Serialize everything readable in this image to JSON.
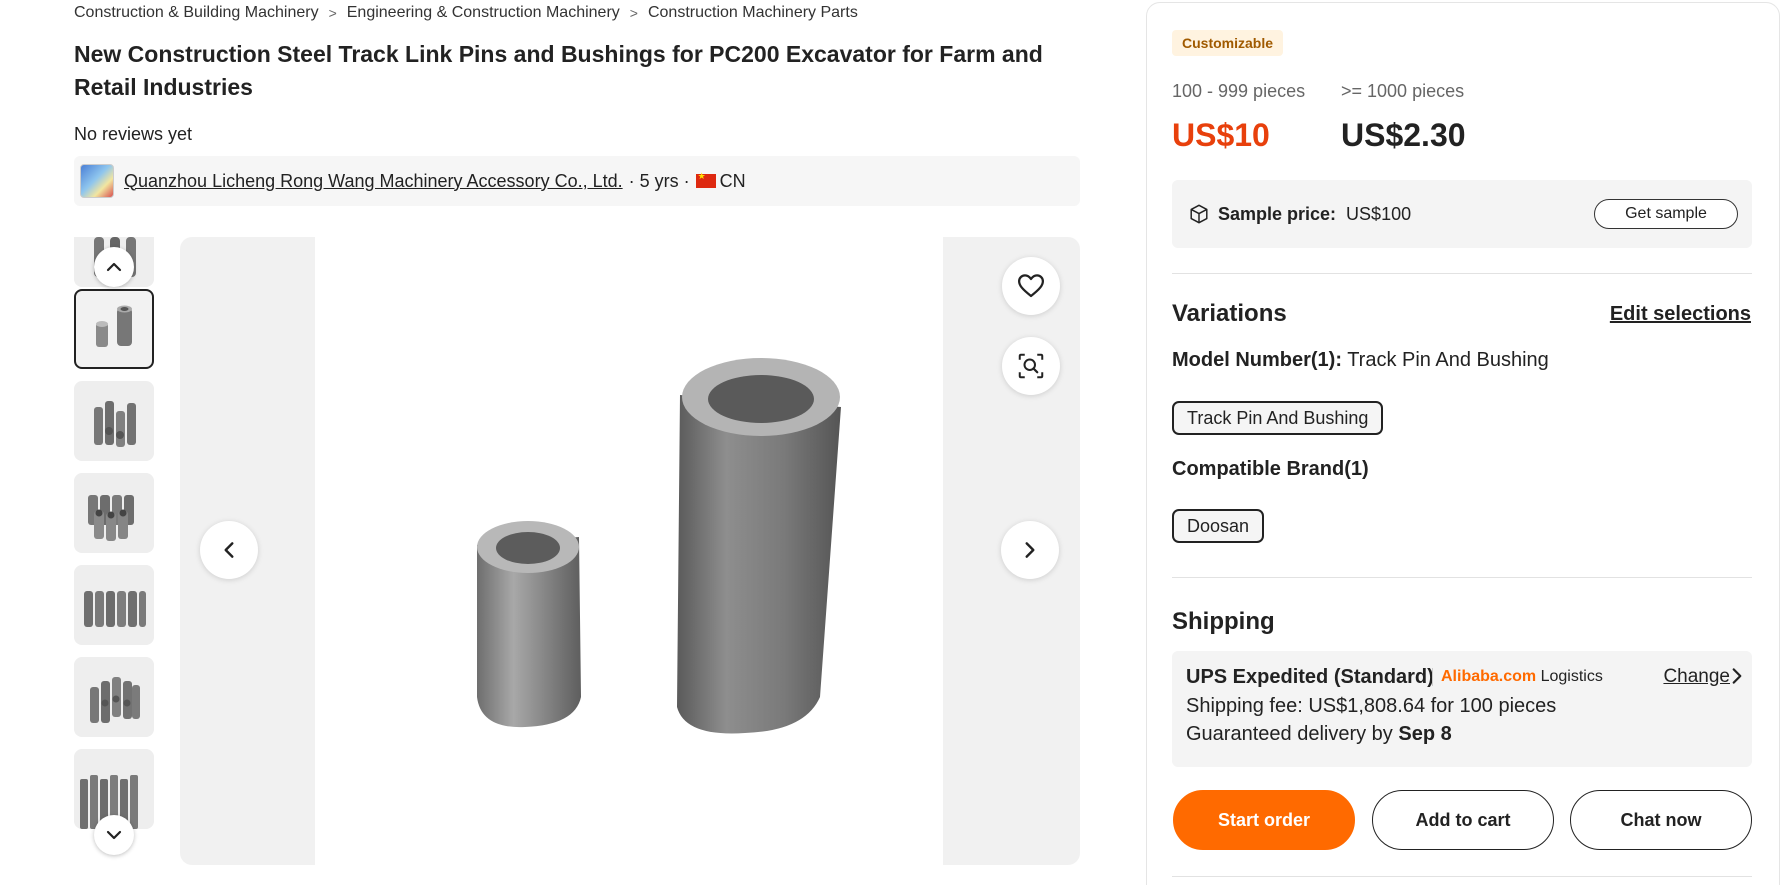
{
  "breadcrumb": [
    {
      "label": "Construction & Building Machinery"
    },
    {
      "label": "Engineering & Construction Machinery"
    },
    {
      "label": "Construction Machinery Parts"
    }
  ],
  "product": {
    "title": "New Construction Steel Track Link Pins and Bushings for PC200 Excavator for Farm and Retail Industries",
    "reviews": "No reviews yet"
  },
  "supplier": {
    "name": "Quanzhou Licheng Rong Wang Machinery Accessory Co., Ltd.",
    "years": "· 5 yrs ·",
    "country": "CN"
  },
  "gallery": {
    "thumb_count": 7,
    "selected_index": 1
  },
  "pricing": {
    "badge": "Customizable",
    "tiers": [
      {
        "range": "100 - 999 pieces",
        "price": "US$10",
        "color": "#e8400c"
      },
      {
        "range": ">= 1000 pieces",
        "price": "US$2.30",
        "color": "#222222"
      }
    ],
    "sample_label": "Sample price:",
    "sample_price": "US$100",
    "get_sample": "Get sample"
  },
  "variations": {
    "heading": "Variations",
    "edit_label": "Edit selections",
    "model_label": "Model Number(1):",
    "model_value": "Track Pin And Bushing",
    "model_chip": "Track Pin And Bushing",
    "brand_label": "Compatible Brand(1)",
    "brand_chip": "Doosan"
  },
  "shipping": {
    "heading": "Shipping",
    "method": "UPS Expedited (Standard)",
    "brand": "Alibaba.com",
    "brand_suffix": "Logistics",
    "change": "Change",
    "fee": "Shipping fee: US$1,808.64 for 100 pieces",
    "delivery_prefix": "Guaranteed delivery by",
    "delivery_date": "Sep 8"
  },
  "actions": {
    "start_order": "Start order",
    "add_to_cart": "Add to cart",
    "chat_now": "Chat now"
  },
  "colors": {
    "accent": "#ff6a00",
    "price_red": "#e8400c"
  }
}
